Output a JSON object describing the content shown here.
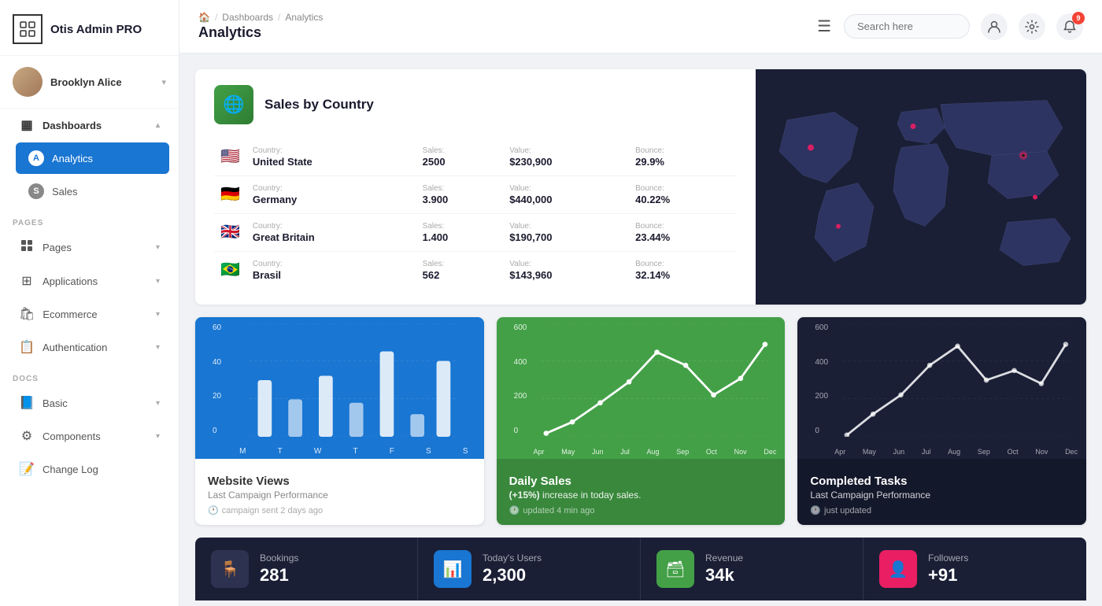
{
  "app": {
    "name": "Otis Admin PRO"
  },
  "sidebar": {
    "user": {
      "name": "Brooklyn Alice"
    },
    "sections": [
      {
        "label": "",
        "items": [
          {
            "id": "dashboards",
            "label": "Dashboards",
            "icon": "▦",
            "type": "parent",
            "expanded": true
          },
          {
            "id": "analytics",
            "label": "Analytics",
            "icon": "A",
            "type": "child",
            "active": true
          },
          {
            "id": "sales",
            "label": "Sales",
            "icon": "S",
            "type": "child"
          }
        ]
      },
      {
        "label": "PAGES",
        "items": [
          {
            "id": "pages",
            "label": "Pages",
            "icon": "🖼"
          },
          {
            "id": "applications",
            "label": "Applications",
            "icon": "⊞"
          },
          {
            "id": "ecommerce",
            "label": "Ecommerce",
            "icon": "🛍"
          },
          {
            "id": "authentication",
            "label": "Authentication",
            "icon": "📋"
          }
        ]
      },
      {
        "label": "DOCS",
        "items": [
          {
            "id": "basic",
            "label": "Basic",
            "icon": "📘"
          },
          {
            "id": "components",
            "label": "Components",
            "icon": "⚙"
          },
          {
            "id": "changelog",
            "label": "Change Log",
            "icon": "📝"
          }
        ]
      }
    ]
  },
  "header": {
    "breadcrumb": [
      "🏠",
      "/",
      "Dashboards",
      "/",
      "Analytics"
    ],
    "title": "Analytics",
    "search_placeholder": "Search here",
    "notif_count": "9"
  },
  "sales_by_country": {
    "title": "Sales by Country",
    "rows": [
      {
        "flag": "🇺🇸",
        "country_label": "Country:",
        "country": "United State",
        "sales_label": "Sales:",
        "sales": "2500",
        "value_label": "Value:",
        "value": "$230,900",
        "bounce_label": "Bounce:",
        "bounce": "29.9%"
      },
      {
        "flag": "🇩🇪",
        "country_label": "Country:",
        "country": "Germany",
        "sales_label": "Sales:",
        "sales": "3.900",
        "value_label": "Value:",
        "value": "$440,000",
        "bounce_label": "Bounce:",
        "bounce": "40.22%"
      },
      {
        "flag": "🇬🇧",
        "country_label": "Country:",
        "country": "Great Britain",
        "sales_label": "Sales:",
        "sales": "1.400",
        "value_label": "Value:",
        "value": "$190,700",
        "bounce_label": "Bounce:",
        "bounce": "23.44%"
      },
      {
        "flag": "🇧🇷",
        "country_label": "Country:",
        "country": "Brasil",
        "sales_label": "Sales:",
        "sales": "562",
        "value_label": "Value:",
        "value": "$143,960",
        "bounce_label": "Bounce:",
        "bounce": "32.14%"
      }
    ]
  },
  "charts": {
    "website_views": {
      "title": "Website Views",
      "subtitle": "Last Campaign Performance",
      "meta": "campaign sent 2 days ago",
      "y_labels": [
        "60",
        "40",
        "20",
        "0"
      ],
      "x_labels": [
        "M",
        "T",
        "W",
        "T",
        "F",
        "S",
        "S"
      ],
      "bars": [
        30,
        20,
        32,
        18,
        45,
        12,
        40
      ]
    },
    "daily_sales": {
      "title": "Daily Sales",
      "subtitle_prefix": "(+15%)",
      "subtitle_suffix": " increase in today sales.",
      "meta": "updated 4 min ago",
      "y_labels": [
        "600",
        "400",
        "200",
        "0"
      ],
      "x_labels": [
        "Apr",
        "May",
        "Jun",
        "Jul",
        "Aug",
        "Sep",
        "Oct",
        "Nov",
        "Dec"
      ],
      "values": [
        20,
        80,
        180,
        290,
        450,
        380,
        220,
        310,
        490
      ]
    },
    "completed_tasks": {
      "title": "Completed Tasks",
      "subtitle": "Last Campaign Performance",
      "meta": "just updated",
      "y_labels": [
        "600",
        "400",
        "200",
        "0"
      ],
      "x_labels": [
        "Apr",
        "May",
        "Jun",
        "Jul",
        "Aug",
        "Sep",
        "Oct",
        "Nov",
        "Dec"
      ],
      "values": [
        10,
        120,
        220,
        380,
        480,
        300,
        350,
        280,
        490
      ]
    }
  },
  "stats": [
    {
      "id": "bookings",
      "label": "Bookings",
      "value": "281",
      "icon": "🪑",
      "color": "dark-gray"
    },
    {
      "id": "today-users",
      "label": "Today's Users",
      "value": "2,300",
      "icon": "📊",
      "color": "blue"
    },
    {
      "id": "revenue",
      "label": "Revenue",
      "value": "34k",
      "icon": "🗃",
      "color": "green"
    },
    {
      "id": "followers",
      "label": "Followers",
      "value": "+91",
      "icon": "👤",
      "color": "pink"
    }
  ]
}
